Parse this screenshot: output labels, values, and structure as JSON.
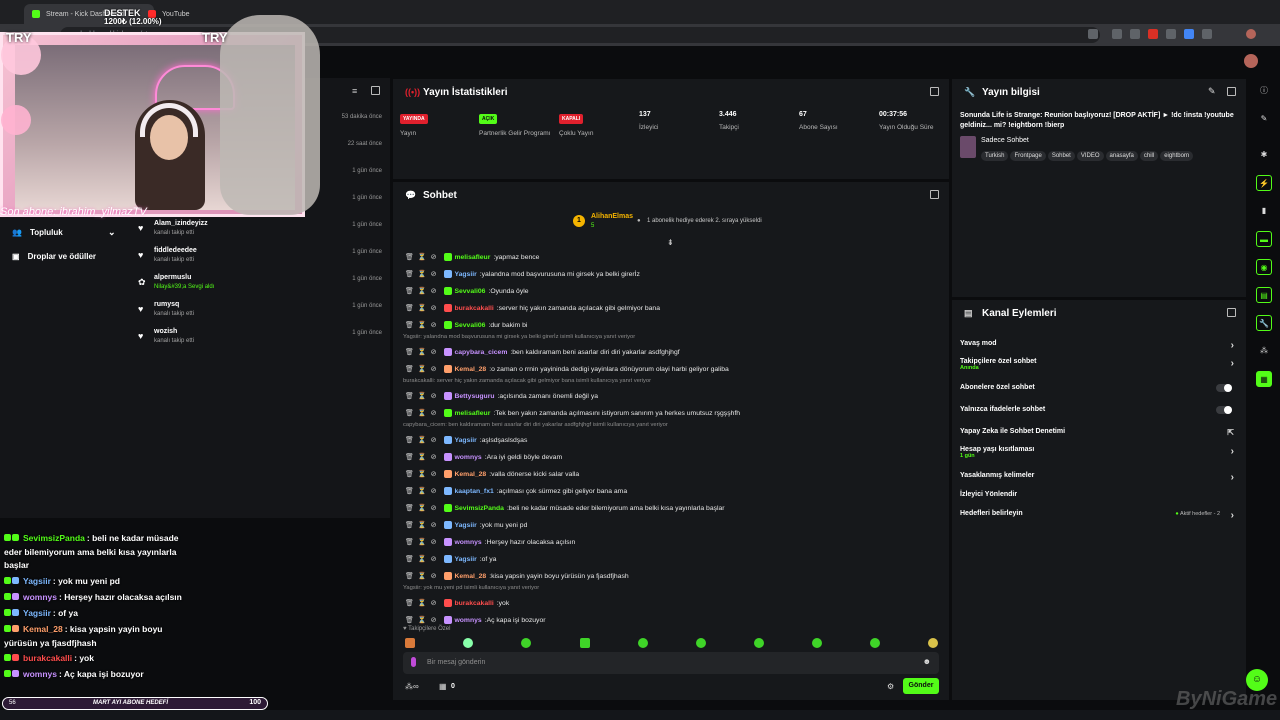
{
  "browser": {
    "tabs": [
      {
        "label": "Stream - Kick Dashboard"
      },
      {
        "label": "YouTube"
      }
    ],
    "url": "dashboard.kick.com/stream"
  },
  "overlay": {
    "goal_title": "DESTEK",
    "goal_progress": "1200₺ (12.00%)",
    "try_left": "TRY",
    "try_right": "TRY",
    "last_sub": "Son abone: ibrahim_yilmazTV",
    "goal_bar": {
      "start": "56",
      "label": "MART AYI ABONE HEDEFİ",
      "value": "100"
    },
    "chat": [
      {
        "user": "SevimsizPanda",
        "text": ": beli ne kadar müsade",
        "color": "#53fc18"
      },
      {
        "user": "",
        "text": "eder bilemiyorum ama belki kısa yayınlarla",
        "color": "#fff"
      },
      {
        "user": "",
        "text": "başlar",
        "color": "#fff"
      },
      {
        "user": "Yagsiir",
        "text": ": yok mu yeni pd",
        "color": "#7db8ff"
      },
      {
        "user": "womnys",
        "text": ": Herşey hazır olacaksa açılsın",
        "color": "#c792ff"
      },
      {
        "user": "Yagsiir",
        "text": ": of ya",
        "color": "#7db8ff"
      },
      {
        "user": "Kemal_28",
        "text": ": kisa yapsin yayin boyu",
        "color": "#ff9f6b"
      },
      {
        "user": "",
        "text": "yürüsün ya fjasdfjhash",
        "color": "#fff"
      },
      {
        "user": "burakcakalli",
        "text": ": yok",
        "color": "#ff4d4d"
      },
      {
        "user": "womnys",
        "text": ": Aç kapa işi bozuyor",
        "color": "#c792ff"
      }
    ]
  },
  "left_panel": {
    "nav": [
      {
        "label": "Topluluk"
      },
      {
        "label": "Droplar ve ödüller"
      }
    ],
    "activity": [
      {
        "time": "53 dakika önce"
      },
      {
        "time": "22 saat önce"
      },
      {
        "time": "1 gün önce"
      },
      {
        "time": "1 gün önce"
      },
      {
        "user": "Alam_izindeyizz",
        "sub": "kanalı takip etti",
        "time": "1 gün önce"
      },
      {
        "user": "fiddledeedee",
        "sub": "kanalı takip etti",
        "time": "1 gün önce"
      },
      {
        "user": "alpermuslu",
        "sub": "Nilay&#39;a Sevgi aldı",
        "time": "1 gün önce"
      },
      {
        "user": "rumysq",
        "sub": "kanalı takip etti",
        "time": "1 gün önce"
      },
      {
        "user": "wozish",
        "sub": "kanalı takip etti",
        "time": "1 gün önce"
      }
    ]
  },
  "stats": {
    "title": "Yayın İstatistikleri",
    "items": [
      {
        "badge": "YAYINDA",
        "label": "Yayın",
        "color": "#e0202d"
      },
      {
        "badge": "AÇIK",
        "label": "Partnerlik Gelir Programı",
        "color": "#53fc18"
      },
      {
        "badge": "KAPALI",
        "label": "Çoklu Yayın",
        "color": "#e0202d"
      },
      {
        "value": "137",
        "label": "İzleyici"
      },
      {
        "value": "3.446",
        "label": "Takipçi"
      },
      {
        "value": "67",
        "label": "Abone Sayısı"
      },
      {
        "value": "00:37:56",
        "label": "Yayın Olduğu Süre"
      }
    ]
  },
  "chat": {
    "title": "Sohbet",
    "pinned": {
      "user": "AlihanElmas",
      "level": "5",
      "text": "1 abonelik hediye ederek 2. sıraya yükseldi"
    },
    "lines": [
      {
        "user": "melisafleur",
        "text": "yapmaz bence",
        "color": "#53fc18"
      },
      {
        "user": "Yagsiir",
        "text": "yalandna mod başvurusuna mi girsek ya belki girerİz",
        "color": "#7db8ff"
      },
      {
        "user": "Sevvali06",
        "text": "Oyunda öyle",
        "color": "#53fc18"
      },
      {
        "user": "burakcakalli",
        "text": "server hiç yakın zamanda açılacak gibi gelmiyor bana",
        "color": "#ff4d4d"
      },
      {
        "user": "Sevvali06",
        "text": "dur bakim bi",
        "color": "#53fc18"
      },
      {
        "hint": "Yagsiir: yalandna mod başvurusuna mi girsek ya belki girerİz isimli kullanıcıya yanıt veriyor"
      },
      {
        "user": "capybara_cicem",
        "text": "ben kaldıramam beni asarlar diri diri yakarlar asdfghjhgf",
        "color": "#c792ff"
      },
      {
        "user": "Kemal_28",
        "text": "o zaman o rrnin yayininda dedigi yayinlara dönüyorum olayi harbi geliyor galiba",
        "color": "#ff9f6b"
      },
      {
        "hint": "burakcakalli: server hiç yakın zamanda açılacak gibi gelmiyor bana isimli kullanıcıya yanıt veriyor"
      },
      {
        "user": "Bettysuguru",
        "text": "açılsında zamanı önemli değil ya",
        "color": "#c792ff"
      },
      {
        "user": "melisafleur",
        "text": "Tek ben yakın zamanda açılmasını istiyorum sanırım ya herkes umutsuz rşgşşhfh",
        "color": "#53fc18"
      },
      {
        "hint": "capybara_cicem: ben kaldıramam beni asarlar diri diri yakarlar asdfghjhgf isimli kullanıcıya yanıt veriyor"
      },
      {
        "user": "Yagsiir",
        "text": "aşlsdşaslsdşas",
        "color": "#7db8ff"
      },
      {
        "user": "womnys",
        "text": "Ara iyi geldi böyle devam",
        "color": "#c792ff"
      },
      {
        "user": "Kemal_28",
        "text": "valla dönerse kicki salar valla",
        "color": "#ff9f6b"
      },
      {
        "user": "kaaptan_fx1",
        "text": "açılması çok sürmez gibi geliyor bana ama",
        "color": "#7db8ff"
      },
      {
        "user": "SevimsizPanda",
        "text": "beli ne kadar müsade eder bilemiyorum ama belki kısa yayınlarla başlar",
        "color": "#53fc18"
      },
      {
        "user": "Yagsiir",
        "text": "yok mu yeni pd",
        "color": "#7db8ff"
      },
      {
        "user": "womnys",
        "text": "Herşey hazır olacaksa açılsın",
        "color": "#c792ff"
      },
      {
        "user": "Yagsiir",
        "text": "of ya",
        "color": "#7db8ff"
      },
      {
        "user": "Kemal_28",
        "text": "kisa yapsin yayin boyu yürüsün ya fjasdfjhash",
        "color": "#ff9f6b"
      },
      {
        "hint": "Yagsiir: yok mu yeni pd isimli kullanıcıya yanıt veriyor"
      },
      {
        "user": "burakcakalli",
        "text": "yok",
        "color": "#ff4d4d"
      },
      {
        "user": "womnys",
        "text": "Aç kapa işi bozuyor",
        "color": "#c792ff"
      }
    ],
    "followers_hint": "Takipçilere Özel",
    "input_placeholder": "Bir mesaj gönderin",
    "points": "0",
    "send": "Gönder"
  },
  "stream_info": {
    "title": "Yayın bilgisi",
    "stream_title": "Sonunda Life is Strange: Reunion başlıyoruz! [DROP AKTİF] ► !dc !insta !youtube geldiniz... mi? !eightborn !bierp",
    "category": "Sadece Sohbet",
    "tags": [
      "Turkish",
      "Frontpage",
      "Sohbet",
      "VIDEO",
      "anasayfa",
      "chill",
      "eightborn"
    ]
  },
  "actions": {
    "title": "Kanal Eylemleri",
    "items": [
      {
        "label": "Yavaş mod",
        "kind": "chevron"
      },
      {
        "label": "Takipçilere özel sohbet",
        "sub": "Anında",
        "kind": "chevron"
      },
      {
        "label": "Abonelere özel sohbet",
        "kind": "toggle"
      },
      {
        "label": "Yalnızca ifadelerle sohbet",
        "kind": "toggle"
      },
      {
        "label": "Yapay Zeka ile Sohbet Denetimi",
        "kind": "external"
      },
      {
        "label": "Hesap yaşı kısıtlaması",
        "sub": "1 gün",
        "kind": "chevron"
      },
      {
        "label": "Yasaklanmış kelimeler",
        "kind": "chevron"
      },
      {
        "label": "İzleyici Yönlendir",
        "kind": "none"
      },
      {
        "label": "Hedefleri belirleyin",
        "kind": "goal",
        "extra": "Aktif hedefler - 2"
      }
    ]
  },
  "watermark": "ByNiGame"
}
